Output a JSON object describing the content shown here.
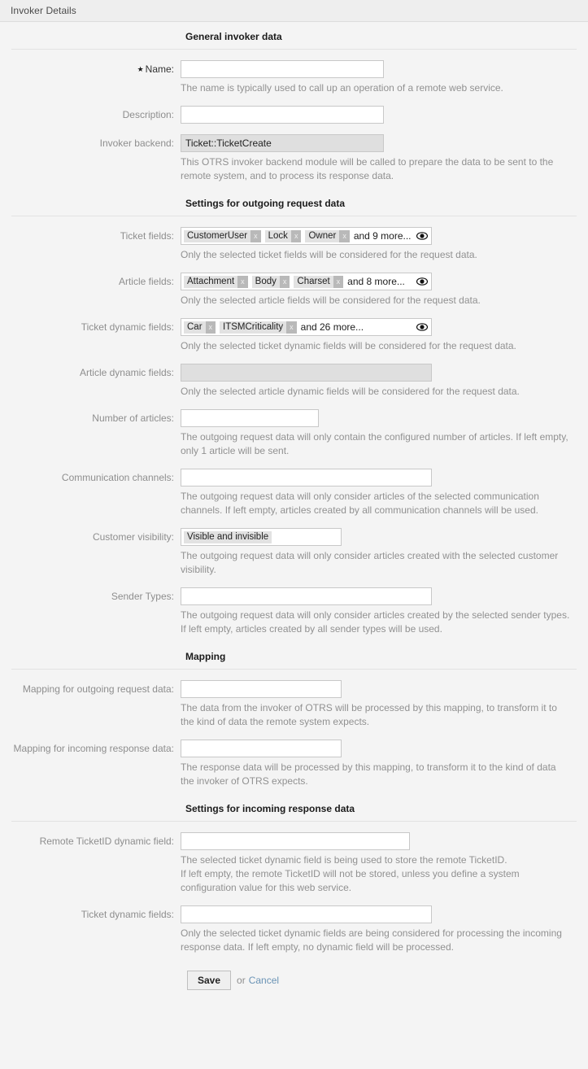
{
  "header": {
    "title": "Invoker Details"
  },
  "sections": {
    "general": {
      "title": "General invoker data",
      "name": {
        "label": "Name:",
        "star": "★",
        "value": "",
        "help": "The name is typically used to call up an operation of a remote web service."
      },
      "description": {
        "label": "Description:",
        "value": ""
      },
      "invoker_backend": {
        "label": "Invoker backend:",
        "value": "Ticket::TicketCreate",
        "help": "This OTRS invoker backend module will be called to prepare the data to be sent to the remote system, and to process its response data."
      }
    },
    "outgoing": {
      "title": "Settings for outgoing request data",
      "ticket_fields": {
        "label": "Ticket fields:",
        "chips": [
          "CustomerUser",
          "Lock",
          "Owner"
        ],
        "remove_label": "x",
        "more": "and 9 more...",
        "icon": "eye-icon",
        "help": "Only the selected ticket fields will be considered for the request data."
      },
      "article_fields": {
        "label": "Article fields:",
        "chips": [
          "Attachment",
          "Body",
          "Charset"
        ],
        "remove_label": "x",
        "more": "and 8 more...",
        "icon": "eye-icon",
        "help": "Only the selected article fields will be considered for the request data."
      },
      "ticket_dynamic_fields": {
        "label": "Ticket dynamic fields:",
        "chips": [
          "Car",
          "ITSMCriticality"
        ],
        "remove_label": "x",
        "more": "and 26 more...",
        "icon": "eye-icon",
        "help": "Only the selected ticket dynamic fields will be considered for the request data."
      },
      "article_dynamic_fields": {
        "label": "Article dynamic fields:",
        "value": "",
        "help": "Only the selected article dynamic fields will be considered for the request data."
      },
      "number_of_articles": {
        "label": "Number of articles:",
        "value": "",
        "help": "The outgoing request data will only contain the configured number of articles. If left empty, only 1 article will be sent."
      },
      "communication_channels": {
        "label": "Communication channels:",
        "value": "",
        "help": "The outgoing request data will only consider articles of the selected communication channels. If left empty, articles created by all communication channels will be used."
      },
      "customer_visibility": {
        "label": "Customer visibility:",
        "selected": "Visible and invisible",
        "help": "The outgoing request data will only consider articles created with the selected customer visibility."
      },
      "sender_types": {
        "label": "Sender Types:",
        "value": "",
        "help": "The outgoing request data will only consider articles created by the selected sender types. If left empty, articles created by all sender types will be used."
      }
    },
    "mapping": {
      "title": "Mapping",
      "outgoing_request": {
        "label": "Mapping for outgoing request data:",
        "value": "",
        "help": "The data from the invoker of OTRS will be processed by this mapping, to transform it to the kind of data the remote system expects."
      },
      "incoming_response": {
        "label": "Mapping for incoming response data:",
        "value": "",
        "help": "The response data will be processed by this mapping, to transform it to the kind of data the invoker of OTRS expects."
      }
    },
    "incoming": {
      "title": "Settings for incoming response data",
      "remote_ticketid_dynamic_field": {
        "label": "Remote TicketID dynamic field:",
        "value": "",
        "help": "The selected ticket dynamic field is being used to store the remote TicketID.\nIf left empty, the remote TicketID will not be stored, unless you define a system configuration value for this web service."
      },
      "ticket_dynamic_fields": {
        "label": "Ticket dynamic fields:",
        "value": "",
        "help": "Only the selected ticket dynamic fields are being considered for processing the incoming response data. If left empty, no dynamic field will be processed."
      }
    }
  },
  "footer": {
    "save_label": "Save",
    "or_label": "or",
    "cancel_label": "Cancel"
  },
  "colors": {
    "page_bg": "#f4f4f4",
    "header_bg": "#eeeeee",
    "label_gray": "#8e8e8e",
    "help_gray": "#919191",
    "chip_bg": "#e2e2e2",
    "chip_x_bg": "#b9b9b9",
    "link_blue": "#6a93b5"
  }
}
